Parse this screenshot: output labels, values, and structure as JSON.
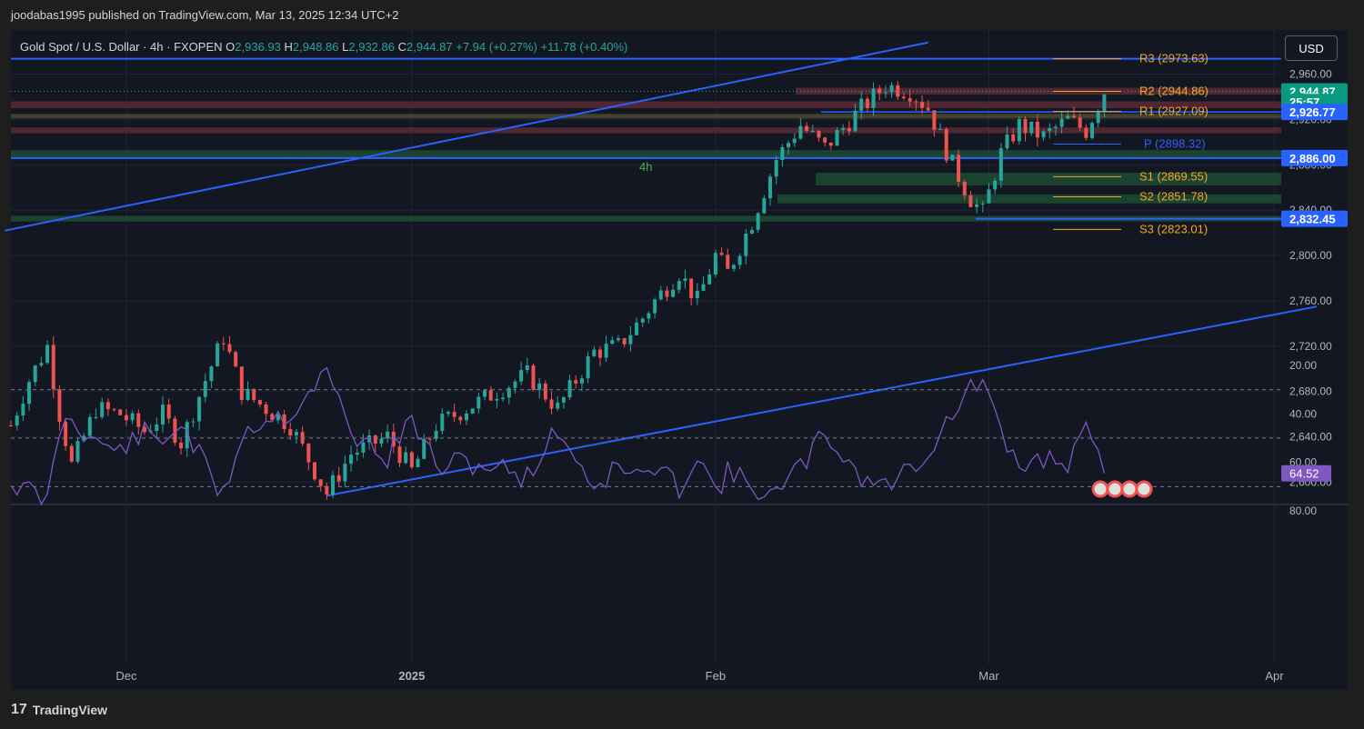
{
  "header": {
    "published": "joodabas1995 published on TradingView.com, Mar 13, 2025 12:34 UTC+2"
  },
  "legend": {
    "symbol": "Gold Spot / U.S. Dollar · 4h · FXOPEN",
    "o_k": "O",
    "o_v": "2,936.93",
    "h_k": "H",
    "h_v": "2,948.86",
    "l_k": "L",
    "l_v": "2,932.86",
    "c_k": "C",
    "c_v": "2,944.87",
    "chg": "+7.94 (+0.27%)",
    "chg2": "+11.78 (+0.40%)"
  },
  "currency_button": "USD",
  "interval_label": "4h",
  "footer": {
    "logo_mark": "17",
    "brand": "TradingView"
  },
  "colors": {
    "bg": "#131722",
    "channel": "#2962ff",
    "up": "#26a69a",
    "down": "#ef5350",
    "pivot_orange": "#f5a623",
    "pivot_blue": "#2962ff",
    "rsi": "#7e57c2",
    "resist_zone": "#5b2a35",
    "support_zone": "#1e4a32"
  },
  "chart_data": [
    {
      "type": "line",
      "title": "",
      "ylim": [
        2585,
        2985
      ],
      "x_ticks": [
        "Dec",
        "2025",
        "Feb",
        "Mar",
        "Apr"
      ],
      "y_ticks": [
        "2,600.00",
        "2,640.00",
        "2,680.00",
        "2,720.00",
        "2,760.00",
        "2,800.00",
        "2,840.00",
        "2,880.00",
        "2,920.00",
        "2,960.00"
      ],
      "price_path": [
        [
          0,
          2650
        ],
        [
          3,
          2690
        ],
        [
          6,
          2720
        ],
        [
          8,
          2660
        ],
        [
          10,
          2615
        ],
        [
          14,
          2665
        ],
        [
          18,
          2660
        ],
        [
          22,
          2645
        ],
        [
          25,
          2660
        ],
        [
          28,
          2635
        ],
        [
          32,
          2690
        ],
        [
          35,
          2728
        ],
        [
          38,
          2680
        ],
        [
          42,
          2665
        ],
        [
          46,
          2650
        ],
        [
          52,
          2590
        ],
        [
          56,
          2625
        ],
        [
          62,
          2640
        ],
        [
          66,
          2610
        ],
        [
          70,
          2650
        ],
        [
          75,
          2665
        ],
        [
          80,
          2680
        ],
        [
          85,
          2695
        ],
        [
          90,
          2665
        ],
        [
          96,
          2715
        ],
        [
          100,
          2720
        ],
        [
          104,
          2745
        ],
        [
          106,
          2760
        ],
        [
          110,
          2785
        ],
        [
          113,
          2760
        ],
        [
          116,
          2800
        ],
        [
          118,
          2785
        ],
        [
          122,
          2830
        ],
        [
          126,
          2885
        ],
        [
          130,
          2915
        ],
        [
          134,
          2895
        ],
        [
          140,
          2930
        ],
        [
          144,
          2950
        ],
        [
          148,
          2945
        ],
        [
          151,
          2930
        ],
        [
          155,
          2880
        ],
        [
          158,
          2850
        ],
        [
          160,
          2838
        ],
        [
          163,
          2890
        ],
        [
          166,
          2915
        ],
        [
          170,
          2905
        ],
        [
          174,
          2920
        ],
        [
          177,
          2910
        ],
        [
          180,
          2945
        ]
      ],
      "last_index": 180,
      "pivots": [
        {
          "label": "R3 (2973.63)",
          "value": 2973.63,
          "color": "orange"
        },
        {
          "label": "R2 (2944.86)",
          "value": 2944.86,
          "color": "orange"
        },
        {
          "label": "R1 (2927.09)",
          "value": 2927.09,
          "color": "orange"
        },
        {
          "label": "P (2898.32)",
          "value": 2898.32,
          "color": "blue"
        },
        {
          "label": "S1 (2869.55)",
          "value": 2869.55,
          "color": "orange"
        },
        {
          "label": "S2 (2851.78)",
          "value": 2851.78,
          "color": "orange"
        },
        {
          "label": "S3 (2823.01)",
          "value": 2823.01,
          "color": "orange"
        }
      ],
      "horizontal_lines": [
        2973.63,
        2886.0,
        2832.45
      ],
      "price_badges": [
        {
          "label": "2,944.87",
          "value": 2944.87,
          "color": "#089981"
        },
        {
          "label": "25:57",
          "value": 2935.5,
          "color": "#089981"
        },
        {
          "label": "2,926.77",
          "value": 2926.77,
          "color": "#2962ff"
        },
        {
          "label": "2,886.00",
          "value": 2886.0,
          "color": "#2962ff"
        },
        {
          "label": "2,832.45",
          "value": 2832.45,
          "color": "#2962ff"
        }
      ],
      "zones": [
        {
          "low": 2942,
          "high": 2948,
          "kind": "resist"
        },
        {
          "low": 2930,
          "high": 2936,
          "kind": "resist"
        },
        {
          "low": 2921,
          "high": 2925,
          "kind": "neutral"
        },
        {
          "low": 2908,
          "high": 2913,
          "kind": "resist"
        },
        {
          "low": 2886,
          "high": 2893,
          "kind": "support"
        },
        {
          "low": 2862,
          "high": 2873,
          "kind": "support"
        },
        {
          "low": 2846,
          "high": 2854,
          "kind": "support"
        },
        {
          "low": 2830,
          "high": 2835,
          "kind": "support"
        }
      ],
      "channel": {
        "upper": [
          [
            -1,
            2822
          ],
          [
            151,
            2988
          ]
        ],
        "lower": [
          [
            52,
            2588
          ],
          [
            215,
            2755
          ]
        ]
      }
    },
    {
      "type": "line",
      "title": "",
      "ylim": [
        20,
        80
      ],
      "y_ticks": [
        "80.00",
        "60.00",
        "40.00",
        "20.00"
      ],
      "bands": [
        30,
        70
      ],
      "mid": 50,
      "rsi_path": [
        [
          0,
          68
        ],
        [
          3,
          72
        ],
        [
          6,
          76
        ],
        [
          8,
          46
        ],
        [
          10,
          41
        ],
        [
          14,
          52
        ],
        [
          18,
          55
        ],
        [
          22,
          48
        ],
        [
          25,
          52
        ],
        [
          28,
          43
        ],
        [
          32,
          62
        ],
        [
          35,
          74
        ],
        [
          38,
          48
        ],
        [
          42,
          42
        ],
        [
          46,
          40
        ],
        [
          52,
          22
        ],
        [
          56,
          48
        ],
        [
          62,
          58
        ],
        [
          66,
          42
        ],
        [
          70,
          62
        ],
        [
          75,
          60
        ],
        [
          80,
          62
        ],
        [
          85,
          66
        ],
        [
          90,
          46
        ],
        [
          96,
          70
        ],
        [
          100,
          62
        ],
        [
          104,
          66
        ],
        [
          106,
          63
        ],
        [
          110,
          70
        ],
        [
          113,
          56
        ],
        [
          116,
          72
        ],
        [
          118,
          64
        ],
        [
          122,
          70
        ],
        [
          126,
          74
        ],
        [
          130,
          62
        ],
        [
          134,
          48
        ],
        [
          140,
          66
        ],
        [
          144,
          70
        ],
        [
          148,
          62
        ],
        [
          151,
          56
        ],
        [
          155,
          40
        ],
        [
          158,
          30
        ],
        [
          160,
          26
        ],
        [
          163,
          50
        ],
        [
          166,
          62
        ],
        [
          170,
          58
        ],
        [
          174,
          60
        ],
        [
          177,
          48
        ],
        [
          180,
          64.52
        ]
      ],
      "current": {
        "label": "64.52",
        "value": 64.52
      }
    }
  ]
}
